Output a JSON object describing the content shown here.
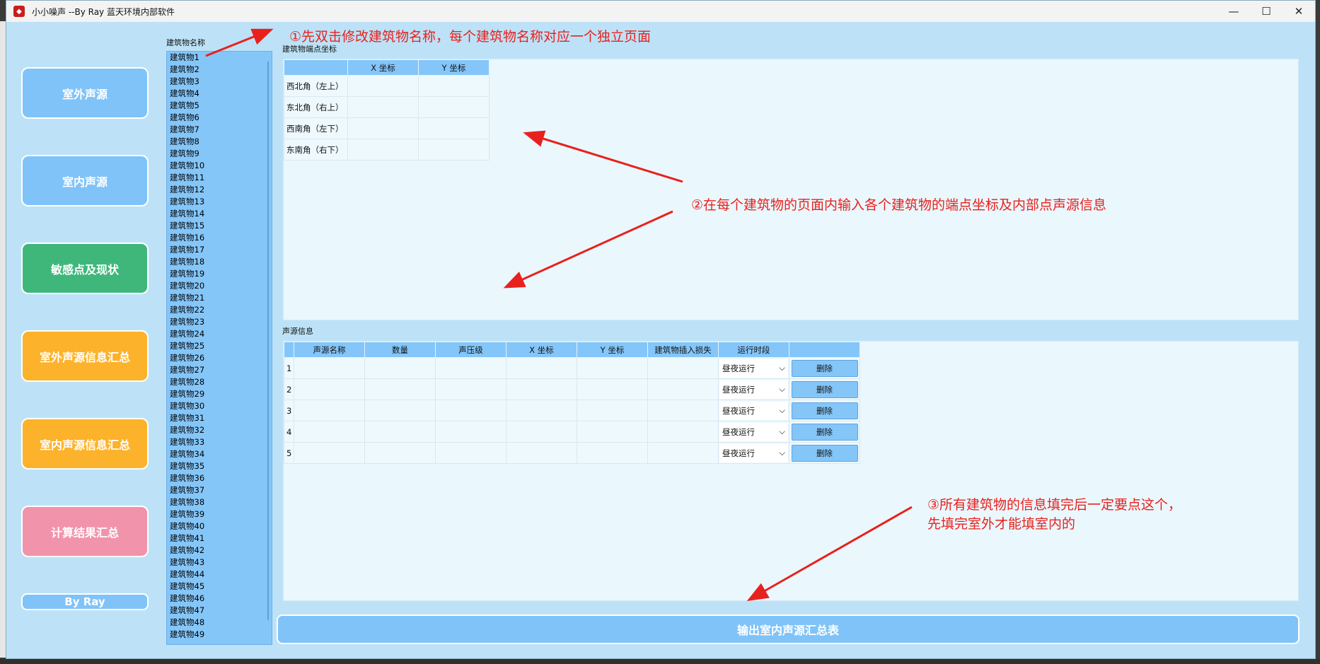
{
  "window": {
    "title": "小小噪声  --By Ray  蓝天环境内部软件",
    "icon": "shield-app-icon",
    "controls": [
      "minimize",
      "maximize",
      "close"
    ]
  },
  "nav": {
    "outdoor_source": "室外声源",
    "indoor_source": "室内声源",
    "sensitive_points": "敏感点及现状",
    "outdoor_summary": "室外声源信息汇总",
    "indoor_summary": "室内声源信息汇总",
    "calc_summary": "计算结果汇总",
    "by_ray": "By Ray"
  },
  "buildings": {
    "label": "建筑物名称",
    "items": [
      "建筑物1",
      "建筑物2",
      "建筑物3",
      "建筑物4",
      "建筑物5",
      "建筑物6",
      "建筑物7",
      "建筑物8",
      "建筑物9",
      "建筑物10",
      "建筑物11",
      "建筑物12",
      "建筑物13",
      "建筑物14",
      "建筑物15",
      "建筑物16",
      "建筑物17",
      "建筑物18",
      "建筑物19",
      "建筑物20",
      "建筑物21",
      "建筑物22",
      "建筑物23",
      "建筑物24",
      "建筑物25",
      "建筑物26",
      "建筑物27",
      "建筑物28",
      "建筑物29",
      "建筑物30",
      "建筑物31",
      "建筑物32",
      "建筑物33",
      "建筑物34",
      "建筑物35",
      "建筑物36",
      "建筑物37",
      "建筑物38",
      "建筑物39",
      "建筑物40",
      "建筑物41",
      "建筑物42",
      "建筑物43",
      "建筑物44",
      "建筑物45",
      "建筑物46",
      "建筑物47",
      "建筑物48",
      "建筑物49"
    ]
  },
  "corners": {
    "label": "建筑物端点坐标",
    "headers": [
      "X 坐标",
      "Y 坐标"
    ],
    "rows": [
      {
        "name": "西北角（左上）",
        "x": "",
        "y": ""
      },
      {
        "name": "东北角（右上）",
        "x": "",
        "y": ""
      },
      {
        "name": "西南角（左下）",
        "x": "",
        "y": ""
      },
      {
        "name": "东南角（右下）",
        "x": "",
        "y": ""
      }
    ]
  },
  "sources": {
    "label": "声源信息",
    "headers": [
      "声源名称",
      "数量",
      "声压级",
      "X 坐标",
      "Y 坐标",
      "建筑物插入损失",
      "运行时段"
    ],
    "rows": [
      {
        "num": "1",
        "period": "昼夜运行",
        "delete": "删除"
      },
      {
        "num": "2",
        "period": "昼夜运行",
        "delete": "删除"
      },
      {
        "num": "3",
        "period": "昼夜运行",
        "delete": "删除"
      },
      {
        "num": "4",
        "period": "昼夜运行",
        "delete": "删除"
      },
      {
        "num": "5",
        "period": "昼夜运行",
        "delete": "删除"
      }
    ]
  },
  "export_button": "输出室内声源汇总表",
  "annotations": {
    "a1": "①先双击修改建筑物名称，每个建筑物名称对应一个独立页面",
    "a2": "②在每个建筑物的页面内输入各个建筑物的端点坐标及内部点声源信息",
    "a3_line1": "③所有建筑物的信息填完后一定要点这个，",
    "a3_line2": "先填完室外才能填室内的",
    "color": "#e8211d"
  },
  "colors": {
    "window_bg": "#bde2f7",
    "blue": "#80c3f8",
    "green": "#3fb77b",
    "orange": "#fdb22b",
    "pink": "#f193ab"
  }
}
